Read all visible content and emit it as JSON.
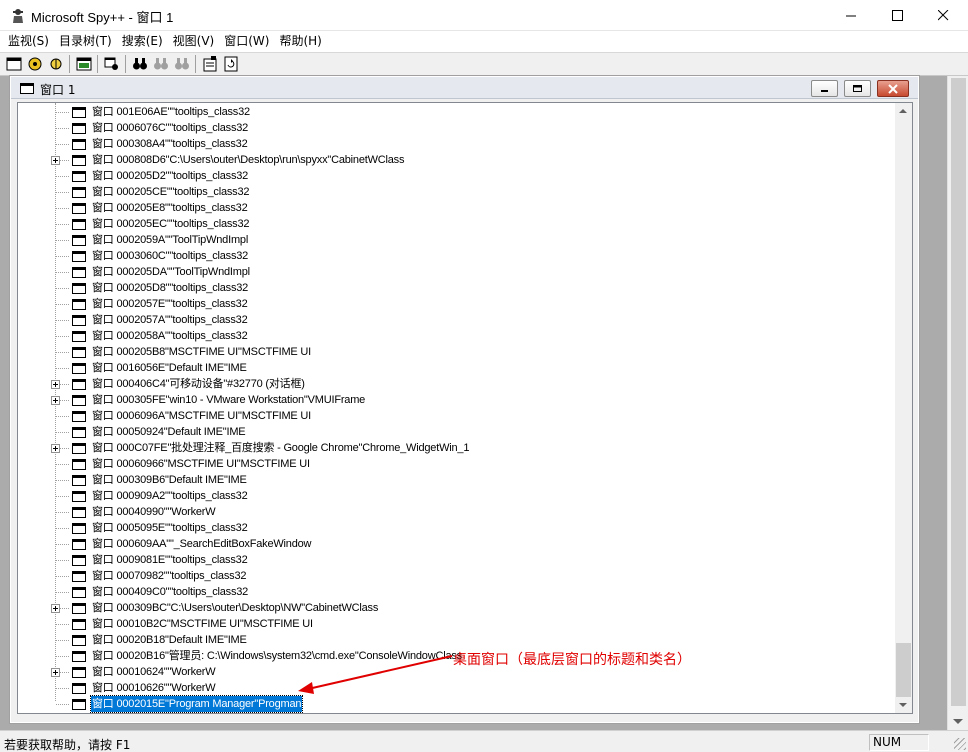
{
  "window": {
    "title": "Microsoft Spy++ - 窗口 1",
    "minimize_glyph": "—",
    "maximize_glyph": "☐",
    "close_glyph": "✕"
  },
  "menu": {
    "items": [
      {
        "label": "监视(S)"
      },
      {
        "label": "目录树(T)"
      },
      {
        "label": "搜索(E)"
      },
      {
        "label": "视图(V)"
      },
      {
        "label": "窗口(W)"
      },
      {
        "label": "帮助(H)"
      }
    ]
  },
  "toolbar": {
    "icons": [
      "windows-icon",
      "processes-icon",
      "threads-icon",
      "messages-icon",
      "find-window-icon",
      "search-icon",
      "find-next-icon",
      "find-prev-icon",
      "properties-icon",
      "refresh-icon"
    ]
  },
  "child_window": {
    "title": "窗口 1"
  },
  "tree": {
    "rows": [
      {
        "text": "窗口 001E06AE\"\"tooltips_class32",
        "expandable": false
      },
      {
        "text": "窗口 0006076C\"\"tooltips_class32",
        "expandable": false
      },
      {
        "text": "窗口 000308A4\"\"tooltips_class32",
        "expandable": false
      },
      {
        "text": "窗口 000808D6\"C:\\Users\\outer\\Desktop\\run\\spyxx\"CabinetWClass",
        "expandable": true
      },
      {
        "text": "窗口 000205D2\"\"tooltips_class32",
        "expandable": false
      },
      {
        "text": "窗口 000205CE\"\"tooltips_class32",
        "expandable": false
      },
      {
        "text": "窗口 000205E8\"\"tooltips_class32",
        "expandable": false
      },
      {
        "text": "窗口 000205EC\"\"tooltips_class32",
        "expandable": false
      },
      {
        "text": "窗口 0002059A\"\"ToolTipWndImpl",
        "expandable": false
      },
      {
        "text": "窗口 0003060C\"\"tooltips_class32",
        "expandable": false
      },
      {
        "text": "窗口 000205DA\"\"ToolTipWndImpl",
        "expandable": false
      },
      {
        "text": "窗口 000205D8\"\"tooltips_class32",
        "expandable": false
      },
      {
        "text": "窗口 0002057E\"\"tooltips_class32",
        "expandable": false
      },
      {
        "text": "窗口 0002057A\"\"tooltips_class32",
        "expandable": false
      },
      {
        "text": "窗口 0002058A\"\"tooltips_class32",
        "expandable": false
      },
      {
        "text": "窗口 000205B8\"MSCTFIME UI\"MSCTFIME UI",
        "expandable": false
      },
      {
        "text": "窗口 0016056E\"Default IME\"IME",
        "expandable": false
      },
      {
        "text": "窗口 000406C4\"可移动设备\"#32770 (对话框)",
        "expandable": true
      },
      {
        "text": "窗口 000305FE\"win10 - VMware Workstation\"VMUIFrame",
        "expandable": true
      },
      {
        "text": "窗口 0006096A\"MSCTFIME UI\"MSCTFIME UI",
        "expandable": false
      },
      {
        "text": "窗口 00050924\"Default IME\"IME",
        "expandable": false
      },
      {
        "text": "窗口 000C07FE\"批处理注释_百度搜索 - Google Chrome\"Chrome_WidgetWin_1",
        "expandable": true
      },
      {
        "text": "窗口 00060966\"MSCTFIME UI\"MSCTFIME UI",
        "expandable": false
      },
      {
        "text": "窗口 000309B6\"Default IME\"IME",
        "expandable": false
      },
      {
        "text": "窗口 000909A2\"\"tooltips_class32",
        "expandable": false
      },
      {
        "text": "窗口 00040990\"\"WorkerW",
        "expandable": false
      },
      {
        "text": "窗口 0005095E\"\"tooltips_class32",
        "expandable": false
      },
      {
        "text": "窗口 000609AA\"\"_SearchEditBoxFakeWindow",
        "expandable": false
      },
      {
        "text": "窗口 0009081E\"\"tooltips_class32",
        "expandable": false
      },
      {
        "text": "窗口 00070982\"\"tooltips_class32",
        "expandable": false
      },
      {
        "text": "窗口 000409C0\"\"tooltips_class32",
        "expandable": false
      },
      {
        "text": "窗口 000309BC\"C:\\Users\\outer\\Desktop\\NW\"CabinetWClass",
        "expandable": true
      },
      {
        "text": "窗口 00010B2C\"MSCTFIME UI\"MSCTFIME UI",
        "expandable": false
      },
      {
        "text": "窗口 00020B18\"Default IME\"IME",
        "expandable": false
      },
      {
        "text": "窗口 00020B16\"管理员: C:\\Windows\\system32\\cmd.exe\"ConsoleWindowClass",
        "expandable": false
      },
      {
        "text": "窗口 00010624\"\"WorkerW",
        "expandable": true
      },
      {
        "text": "窗口 00010626\"\"WorkerW",
        "expandable": false
      },
      {
        "text": "窗口 0002015E\"Program Manager\"Progman",
        "expandable": false,
        "selected": true
      }
    ]
  },
  "annotation": {
    "text": "桌面窗口（最底层窗口的标题和类名）",
    "color": "#e00000"
  },
  "status": {
    "help_text": "若要获取帮助，请按 F1",
    "num_indicator": "NUM"
  }
}
